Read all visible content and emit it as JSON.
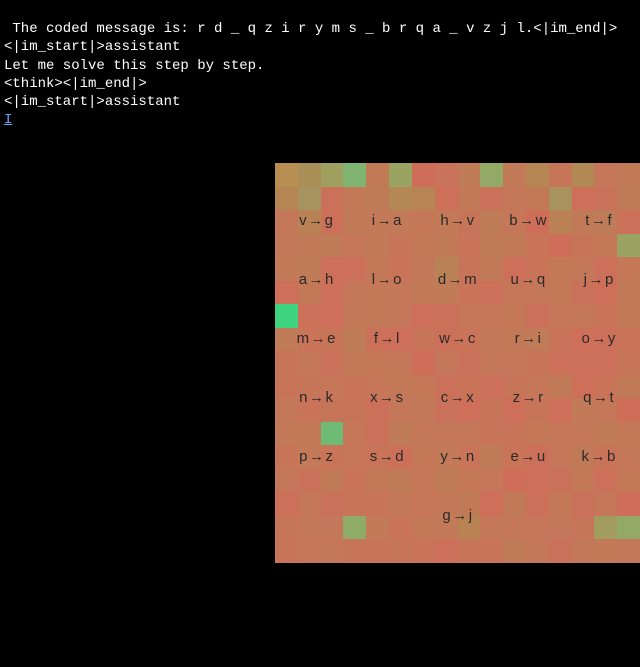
{
  "terminal": {
    "line1": " The coded message is: r d _ q z i r y m s _ b r q a _ v z j l.<|im_end|>",
    "line2": "<|im_start|>assistant",
    "line3": "Let me solve this step by step.",
    "line4": "<think><|im_end|>",
    "line5": "<|im_start|>assistant",
    "cursor": "I"
  },
  "cipher": {
    "rows": [
      [
        {
          "from": "v",
          "to": "g"
        },
        {
          "from": "i",
          "to": "a"
        },
        {
          "from": "h",
          "to": "v"
        },
        {
          "from": "b",
          "to": "w"
        },
        {
          "from": "t",
          "to": "f"
        }
      ],
      [
        {
          "from": "a",
          "to": "h"
        },
        {
          "from": "l",
          "to": "o"
        },
        {
          "from": "d",
          "to": "m"
        },
        {
          "from": "u",
          "to": "q"
        },
        {
          "from": "j",
          "to": "p"
        }
      ],
      [
        {
          "from": "m",
          "to": "e"
        },
        {
          "from": "f",
          "to": "l"
        },
        {
          "from": "w",
          "to": "c"
        },
        {
          "from": "r",
          "to": "i"
        },
        {
          "from": "o",
          "to": "y"
        }
      ],
      [
        {
          "from": "n",
          "to": "k"
        },
        {
          "from": "x",
          "to": "s"
        },
        {
          "from": "c",
          "to": "x"
        },
        {
          "from": "z",
          "to": "r"
        },
        {
          "from": "q",
          "to": "t"
        }
      ],
      [
        {
          "from": "p",
          "to": "z"
        },
        {
          "from": "s",
          "to": "d"
        },
        {
          "from": "y",
          "to": "n"
        },
        {
          "from": "e",
          "to": "u"
        },
        {
          "from": "k",
          "to": "b"
        }
      ],
      [
        null,
        null,
        {
          "from": "g",
          "to": "j"
        },
        null,
        null
      ]
    ]
  },
  "heatmap_colors": [
    [
      "#b88f52",
      "#aa8f59",
      "#9fa05f",
      "#80b471",
      "#c07a56",
      "#9ba363",
      "#ce6e59",
      "#c8735a",
      "#c07b58",
      "#93a967",
      "#c27a58",
      "#b58654",
      "#c77559",
      "#b18954",
      "#c67659",
      "#c17a57"
    ],
    [
      "#b58653",
      "#a79360",
      "#cb7159",
      "#c37958",
      "#bf7b58",
      "#b38854",
      "#b78554",
      "#cd6f59",
      "#c27957",
      "#cb7159",
      "#c57759",
      "#c37958",
      "#a8925e",
      "#cd6f59",
      "#ca7259",
      "#c07b58"
    ],
    [
      "#c47859",
      "#b98254",
      "#cc7059",
      "#c17a58",
      "#c27a58",
      "#c27a58",
      "#c47858",
      "#c27a58",
      "#c77559",
      "#be7d58",
      "#c67659",
      "#ce6e59",
      "#ba8154",
      "#c17a58",
      "#bf7c58",
      "#cb7159"
    ],
    [
      "#c37959",
      "#c17a58",
      "#c07b58",
      "#c67659",
      "#c17b58",
      "#c77559",
      "#c37958",
      "#c17a58",
      "#c97359",
      "#c07b58",
      "#c17a58",
      "#c97359",
      "#ce6e59",
      "#c77559",
      "#c47858",
      "#9ba363"
    ],
    [
      "#c27a58",
      "#c07b58",
      "#cd6f59",
      "#cc7059",
      "#c37958",
      "#c97359",
      "#c37959",
      "#b98254",
      "#c77559",
      "#c17b58",
      "#cd6f59",
      "#c97359",
      "#c47858",
      "#c57759",
      "#cc7059",
      "#c47858"
    ],
    [
      "#cd6f59",
      "#c37958",
      "#cc7059",
      "#c57759",
      "#c47858",
      "#c57759",
      "#c27a58",
      "#c07b58",
      "#c97359",
      "#cc7059",
      "#c67659",
      "#c57759",
      "#c47858",
      "#ca7259",
      "#cd6f59",
      "#c17a58"
    ],
    [
      "#3fd47f",
      "#cc7059",
      "#cd6f59",
      "#c47859",
      "#c37958",
      "#c47859",
      "#cd6f59",
      "#cb7159",
      "#c67659",
      "#c67659",
      "#c47858",
      "#cb7159",
      "#c67659",
      "#c57759",
      "#c97359",
      "#c27a58"
    ],
    [
      "#c07b58",
      "#c97359",
      "#c87459",
      "#bf7c58",
      "#cc7059",
      "#cd6f59",
      "#c87459",
      "#cb7159",
      "#c97359",
      "#c37959",
      "#c37958",
      "#c07b58",
      "#c97359",
      "#cd6f59",
      "#cc7059",
      "#c97359"
    ],
    [
      "#c87459",
      "#c47859",
      "#ca7259",
      "#c37958",
      "#c47858",
      "#c47859",
      "#ce6e59",
      "#c57759",
      "#ca7259",
      "#c47859",
      "#c67659",
      "#c77559",
      "#cc7059",
      "#cc7059",
      "#cc7059",
      "#c77559"
    ],
    [
      "#c87459",
      "#c77559",
      "#c67659",
      "#c97359",
      "#c67659",
      "#c37958",
      "#c47858",
      "#cb7159",
      "#c97359",
      "#cc7059",
      "#c77559",
      "#c67659",
      "#c17a58",
      "#cd6f59",
      "#c97359",
      "#c17a58"
    ],
    [
      "#c57759",
      "#c97359",
      "#c77559",
      "#c77559",
      "#cc7059",
      "#c47859",
      "#c37959",
      "#ca7259",
      "#cd6f59",
      "#c77559",
      "#cd6f59",
      "#c77559",
      "#cd6f59",
      "#c27a58",
      "#c57759",
      "#ce6e59"
    ],
    [
      "#c27a58",
      "#c27a58",
      "#6fbb76",
      "#c67659",
      "#cb7159",
      "#c07b58",
      "#c47859",
      "#c57759",
      "#c57759",
      "#c87459",
      "#c87459",
      "#c47858",
      "#c67659",
      "#c57759",
      "#c07b58",
      "#c47858"
    ],
    [
      "#c77559",
      "#c27a58",
      "#c97359",
      "#c67659",
      "#c87459",
      "#cc7059",
      "#c47858",
      "#c27a58",
      "#c87459",
      "#c07b58",
      "#c97359",
      "#cc7059",
      "#c67659",
      "#c17a58",
      "#c97359",
      "#c57759"
    ],
    [
      "#c57759",
      "#ca7259",
      "#c17a58",
      "#c97359",
      "#c37958",
      "#c07b58",
      "#c67659",
      "#c07b58",
      "#c47858",
      "#c67659",
      "#ce6e59",
      "#cd6f59",
      "#ca7259",
      "#c37958",
      "#cc7059",
      "#c37958"
    ],
    [
      "#cc7059",
      "#c57759",
      "#ca7259",
      "#c77559",
      "#c87459",
      "#c37959",
      "#c67659",
      "#c47859",
      "#c17a58",
      "#cd6f59",
      "#c17a58",
      "#cc7059",
      "#c37958",
      "#ca7259",
      "#c57759",
      "#ce6e59"
    ],
    [
      "#c77559",
      "#c57759",
      "#c37959",
      "#8fab68",
      "#c17b58",
      "#c97359",
      "#c37958",
      "#c27a58",
      "#b88253",
      "#c47859",
      "#c57759",
      "#c67659",
      "#c47859",
      "#c77559",
      "#a29c5f",
      "#93a967"
    ],
    [
      "#c87459",
      "#c67659",
      "#c47859",
      "#c77559",
      "#c87459",
      "#c77559",
      "#c97359",
      "#cc7059",
      "#c77559",
      "#c87459",
      "#c07b58",
      "#c47859",
      "#ca7259",
      "#c37959",
      "#c27a58",
      "#c37959"
    ]
  ]
}
